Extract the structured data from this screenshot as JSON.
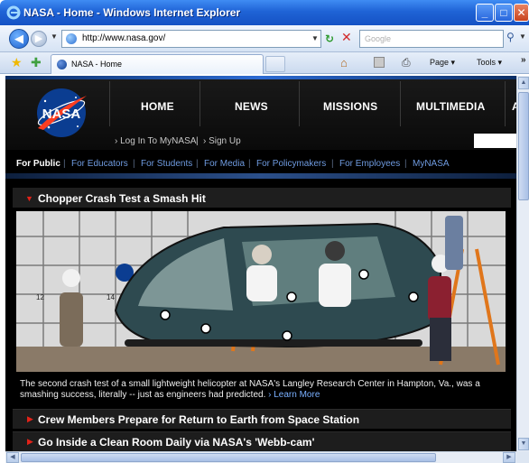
{
  "window": {
    "title": "NASA - Home - Windows Internet Explorer",
    "min_glyph": "_",
    "max_glyph": "□",
    "close_glyph": "✕"
  },
  "address": {
    "url": "http://www.nasa.gov/",
    "search_placeholder": "Google"
  },
  "tabs": [
    {
      "label": "NASA - Home"
    }
  ],
  "commands": {
    "page": "Page ▾",
    "tools": "Tools ▾",
    "more": "»"
  },
  "nasa": {
    "logo_text": "NASA",
    "nav": [
      "HOME",
      "NEWS",
      "MISSIONS",
      "MULTIMEDIA",
      "A"
    ],
    "login": "› Log In To MyNASA",
    "signup": "› Sign Up",
    "login_sep": "|",
    "audiences": [
      "For Public",
      "For Educators",
      "For Students",
      "For Media",
      "For Policymakers",
      "For Employees",
      "MyNASA"
    ],
    "audience_sep": "|"
  },
  "feature": {
    "title": "Chopper Crash Test a Smash Hit",
    "caption": "The second crash test of a small lightweight helicopter at NASA's Langley Research Center in Hampton, Va., was a smashing success, literally -- just as engineers had predicted.",
    "learn_more": "› Learn More",
    "board_numbers": [
      "12",
      "14"
    ]
  },
  "stories": [
    {
      "title": "Crew Members Prepare for Return to Earth from Space Station"
    },
    {
      "title": "Go Inside a Clean Room Daily via NASA's 'Webb-cam'"
    }
  ],
  "colors": {
    "titlebar": "#1f63d6",
    "nasa_blue": "#0b3d91",
    "nasa_red": "#fc3d21",
    "link_blue": "#6f9be0",
    "accent_red": "#e32219"
  }
}
